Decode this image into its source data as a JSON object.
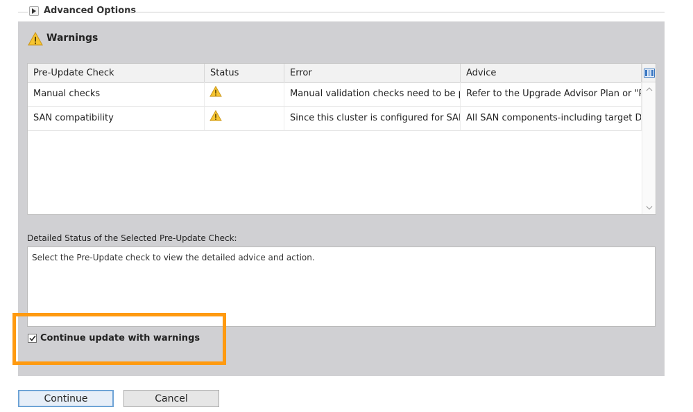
{
  "advanced_options": {
    "label": "Advanced Options"
  },
  "warnings": {
    "title": "Warnings",
    "columns": [
      "Pre-Update Check",
      "Status",
      "Error",
      "Advice"
    ],
    "rows": [
      {
        "check": "Manual checks",
        "status_icon": "warning-icon",
        "error": "Manual validation checks need to be p...",
        "advice": "Refer to the Upgrade Advisor Plan or \"P..."
      },
      {
        "check": "SAN compatibility",
        "status_icon": "warning-icon",
        "error": "Since this cluster is configured for SAN...",
        "advice": "All SAN components-including target Da..."
      }
    ]
  },
  "detail": {
    "label": "Detailed Status of the Selected Pre-Update Check:",
    "text": "Select the Pre-Update check to view the detailed advice and action."
  },
  "continue_with_warnings": {
    "label": "Continue update with warnings",
    "checked": true
  },
  "buttons": {
    "continue": "Continue",
    "cancel": "Cancel"
  },
  "colors": {
    "panel": "#d0d0d3",
    "highlight": "#ff9a10",
    "warning": "#f2c12e",
    "primary_border": "#6ea3d6"
  }
}
